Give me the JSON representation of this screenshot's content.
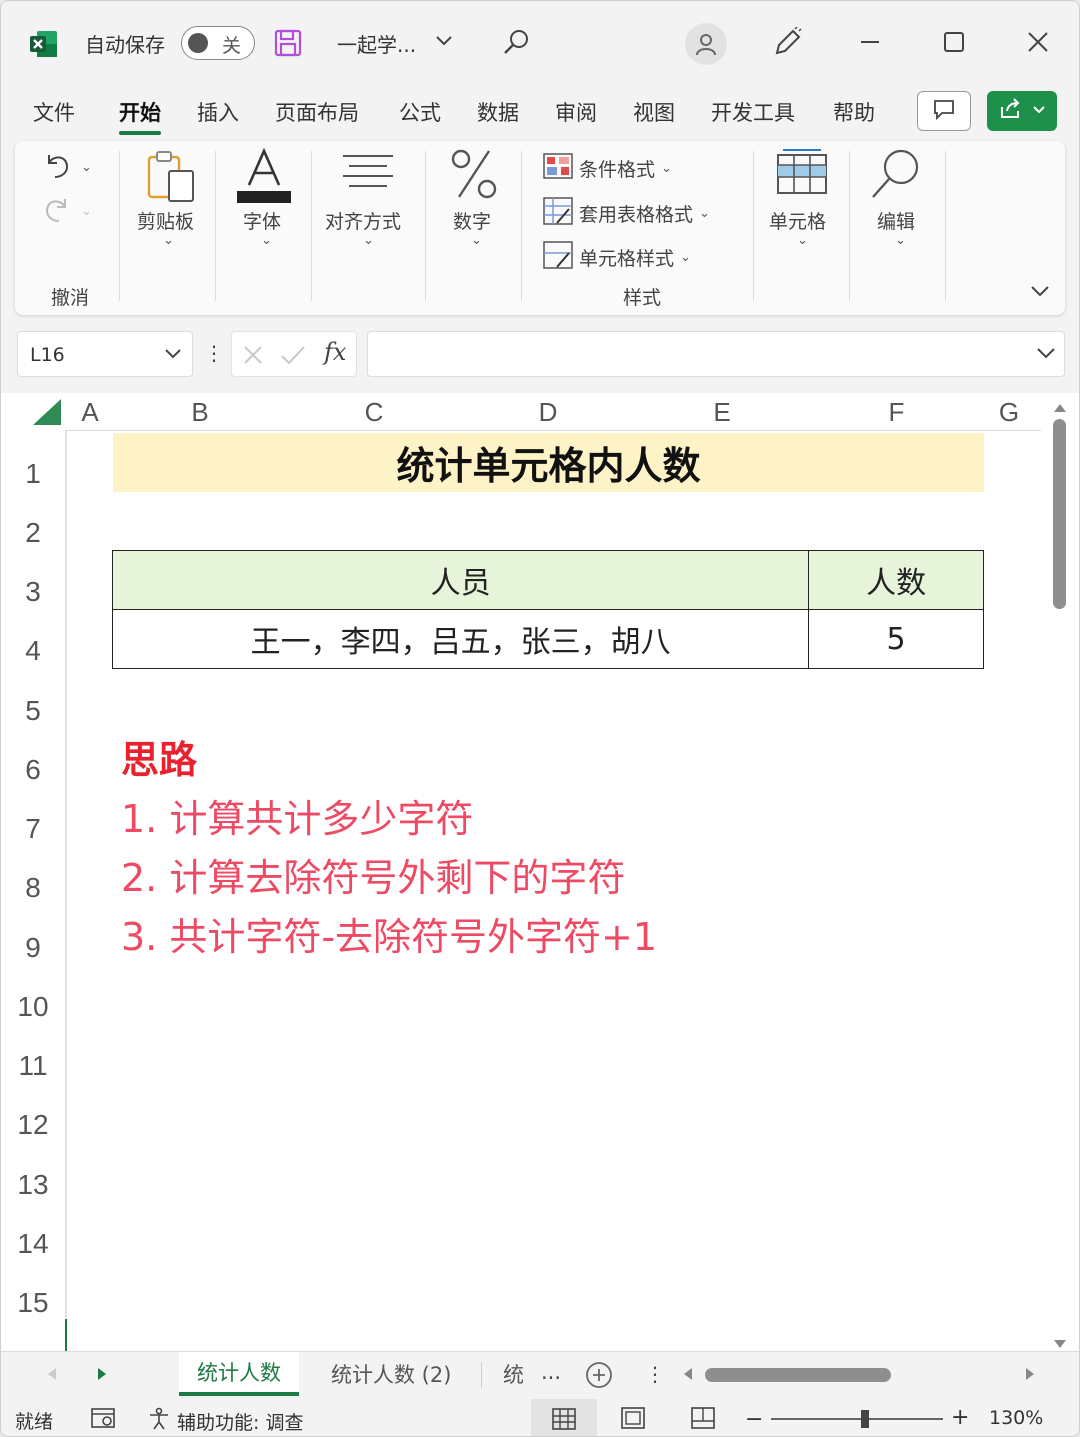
{
  "titlebar": {
    "autosave_label": "自动保存",
    "autosave_state": "关",
    "doc_name": "一起学...",
    "icons": [
      "excel-logo-icon",
      "save-icon",
      "chevron-down-icon",
      "search-icon",
      "avatar-icon",
      "pen-icon",
      "minimize-icon",
      "maximize-icon",
      "close-icon"
    ]
  },
  "menu": {
    "tabs": [
      "文件",
      "开始",
      "插入",
      "页面布局",
      "公式",
      "数据",
      "审阅",
      "视图",
      "开发工具",
      "帮助"
    ],
    "active": "开始"
  },
  "ribbon": {
    "undo_group_label": "撤消",
    "clipboard": "剪贴板",
    "font": "字体",
    "align": "对齐方式",
    "number": "数字",
    "conditional_format": "条件格式",
    "table_format": "套用表格格式",
    "cell_style": "单元格样式",
    "styles_group_label": "样式",
    "cells": "单元格",
    "editing": "编辑"
  },
  "formula_bar": {
    "name_box": "L16",
    "fx": "fx",
    "value": ""
  },
  "columns": [
    "A",
    "B",
    "C",
    "D",
    "E",
    "F",
    "G"
  ],
  "rows": [
    "1",
    "2",
    "3",
    "4",
    "5",
    "6",
    "7",
    "8",
    "9",
    "10",
    "11",
    "12",
    "13",
    "14",
    "15"
  ],
  "sheet": {
    "title": "统计单元格内人数",
    "table_headers": [
      "人员",
      "人数"
    ],
    "table_row": [
      "王一，李四，吕五，张三，胡八",
      "5"
    ],
    "notes_heading": "思路",
    "notes": [
      "1. 计算共计多少字符",
      "2. 计算去除符号外剩下的字符",
      "3. 共计字符-去除符号外字符+1"
    ]
  },
  "sheet_tabs": {
    "tabs": [
      "统计人数",
      "统计人数 (2)",
      "统"
    ],
    "active": "统计人数",
    "more": "..."
  },
  "statusbar": {
    "ready": "就绪",
    "accessibility": "辅助功能: 调查",
    "zoom": "130%"
  },
  "colors": {
    "accent": "#1e7a45",
    "title_fill": "#fdf3c6",
    "header_fill": "#e6f4d9",
    "note_heading": "#e8232f",
    "note_text": "#ee4a63"
  }
}
